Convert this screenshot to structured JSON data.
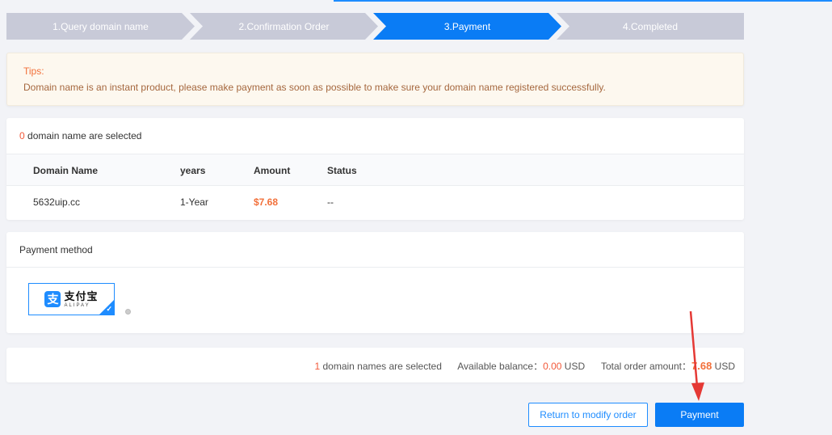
{
  "steps": [
    {
      "label": "1.Query domain name",
      "state": "done"
    },
    {
      "label": "2.Confirmation Order",
      "state": "done"
    },
    {
      "label": "3.Payment",
      "state": "active"
    },
    {
      "label": "4.Completed",
      "state": "todo"
    }
  ],
  "tips": {
    "title": "Tips:",
    "text": "Domain name is an instant product, please make payment as soon as possible to make sure your domain name registered successfully."
  },
  "selection": {
    "count": "0",
    "label": "domain name are selected"
  },
  "table": {
    "headers": [
      "Domain Name",
      "years",
      "Amount",
      "Status"
    ],
    "rows": [
      {
        "domain": "5632uip.cc",
        "years": "1-Year",
        "amount": "$7.68",
        "status": "--"
      }
    ]
  },
  "payment": {
    "title": "Payment method",
    "method_cn": "支付宝",
    "method_en": "ALIPAY"
  },
  "summary": {
    "count": "1",
    "count_label": "domain names are selected",
    "balance_label": "Available balance：",
    "balance_value": "0.00",
    "balance_unit": "USD",
    "total_label": "Total order amount：",
    "total_value": "7.68",
    "total_unit": "USD"
  },
  "buttons": {
    "return_label": "Return to modify order",
    "pay_label": "Payment"
  },
  "colors": {
    "accent": "#1e8cff",
    "step_inactive": "#c8cad8",
    "highlight": "#f2703a",
    "annotation": "#e53935"
  }
}
